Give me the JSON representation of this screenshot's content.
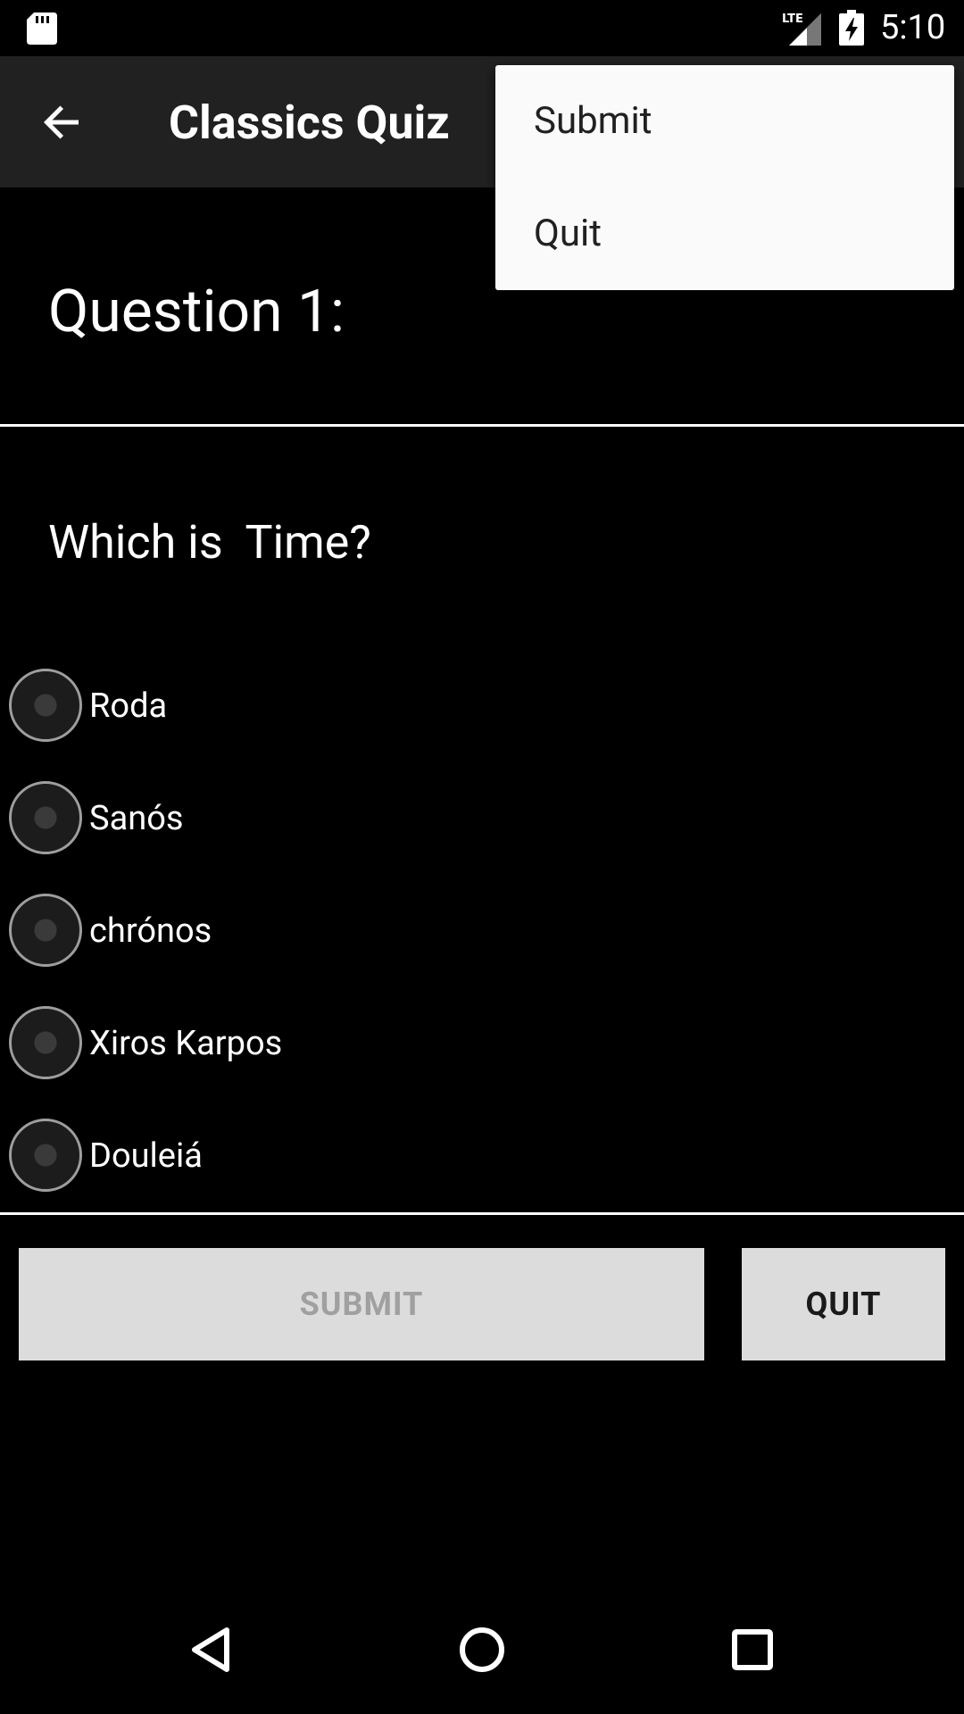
{
  "status_bar": {
    "time": "5:10",
    "network_label": "LTE"
  },
  "app_bar": {
    "title": "Classics Quiz"
  },
  "overflow_menu": {
    "items": [
      {
        "label": "Submit"
      },
      {
        "label": "Quit"
      }
    ]
  },
  "question": {
    "heading": "Question 1:",
    "text": "Which is  Time?"
  },
  "options": [
    {
      "label": "Roda",
      "selected": false
    },
    {
      "label": "Sanós",
      "selected": false
    },
    {
      "label": "chrónos",
      "selected": false
    },
    {
      "label": "Xiros Karpos",
      "selected": false
    },
    {
      "label": "Douleiá",
      "selected": false
    }
  ],
  "buttons": {
    "submit_label": "SUBMIT",
    "submit_enabled": false,
    "quit_label": "QUIT"
  },
  "colors": {
    "background": "#000000",
    "app_bar": "#212121",
    "menu_background": "#fafafa",
    "button_background": "#dcdcdc",
    "disabled_text": "#a0a0a0"
  },
  "icons": {
    "status": [
      "sd-card-icon",
      "signal-icon",
      "battery-charging-icon"
    ],
    "app_bar": [
      "back-arrow-icon"
    ],
    "navigation": [
      "nav-back-icon",
      "nav-home-icon",
      "nav-recents-icon"
    ]
  }
}
